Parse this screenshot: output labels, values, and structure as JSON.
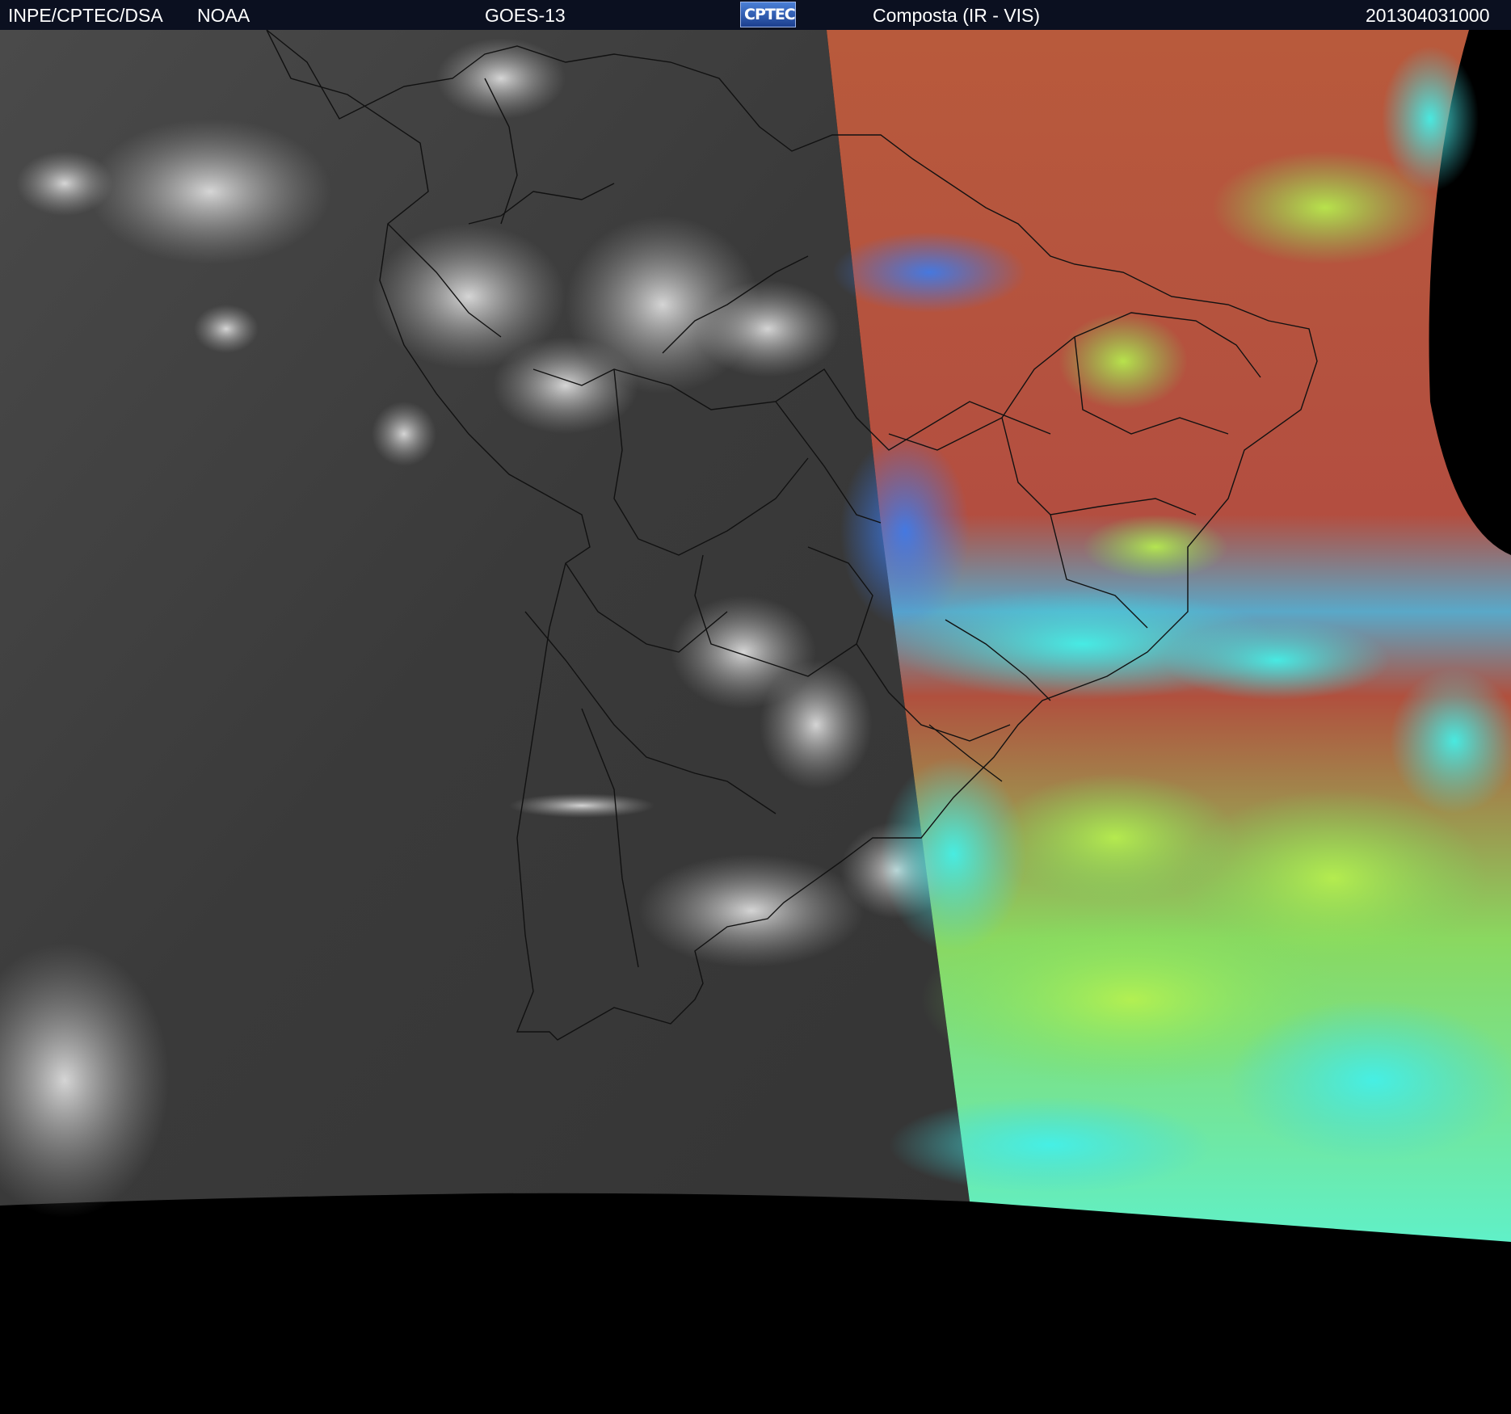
{
  "header": {
    "agency": "INPE/CPTEC/DSA",
    "source": "NOAA",
    "satellite": "GOES-13",
    "logo_text": "CPTEC",
    "product": "Composta (IR - VIS)",
    "timestamp": "201304031000"
  },
  "image": {
    "description_icon": "satellite-composite-image",
    "colors": {
      "header_bg": "#0b1020",
      "night_side_gray": "#3e3e3e",
      "day_side_red": "#b4503c",
      "cloud_cyan": "#40e8e0",
      "cloud_green": "#9ee84a",
      "space_black": "#000000"
    }
  }
}
